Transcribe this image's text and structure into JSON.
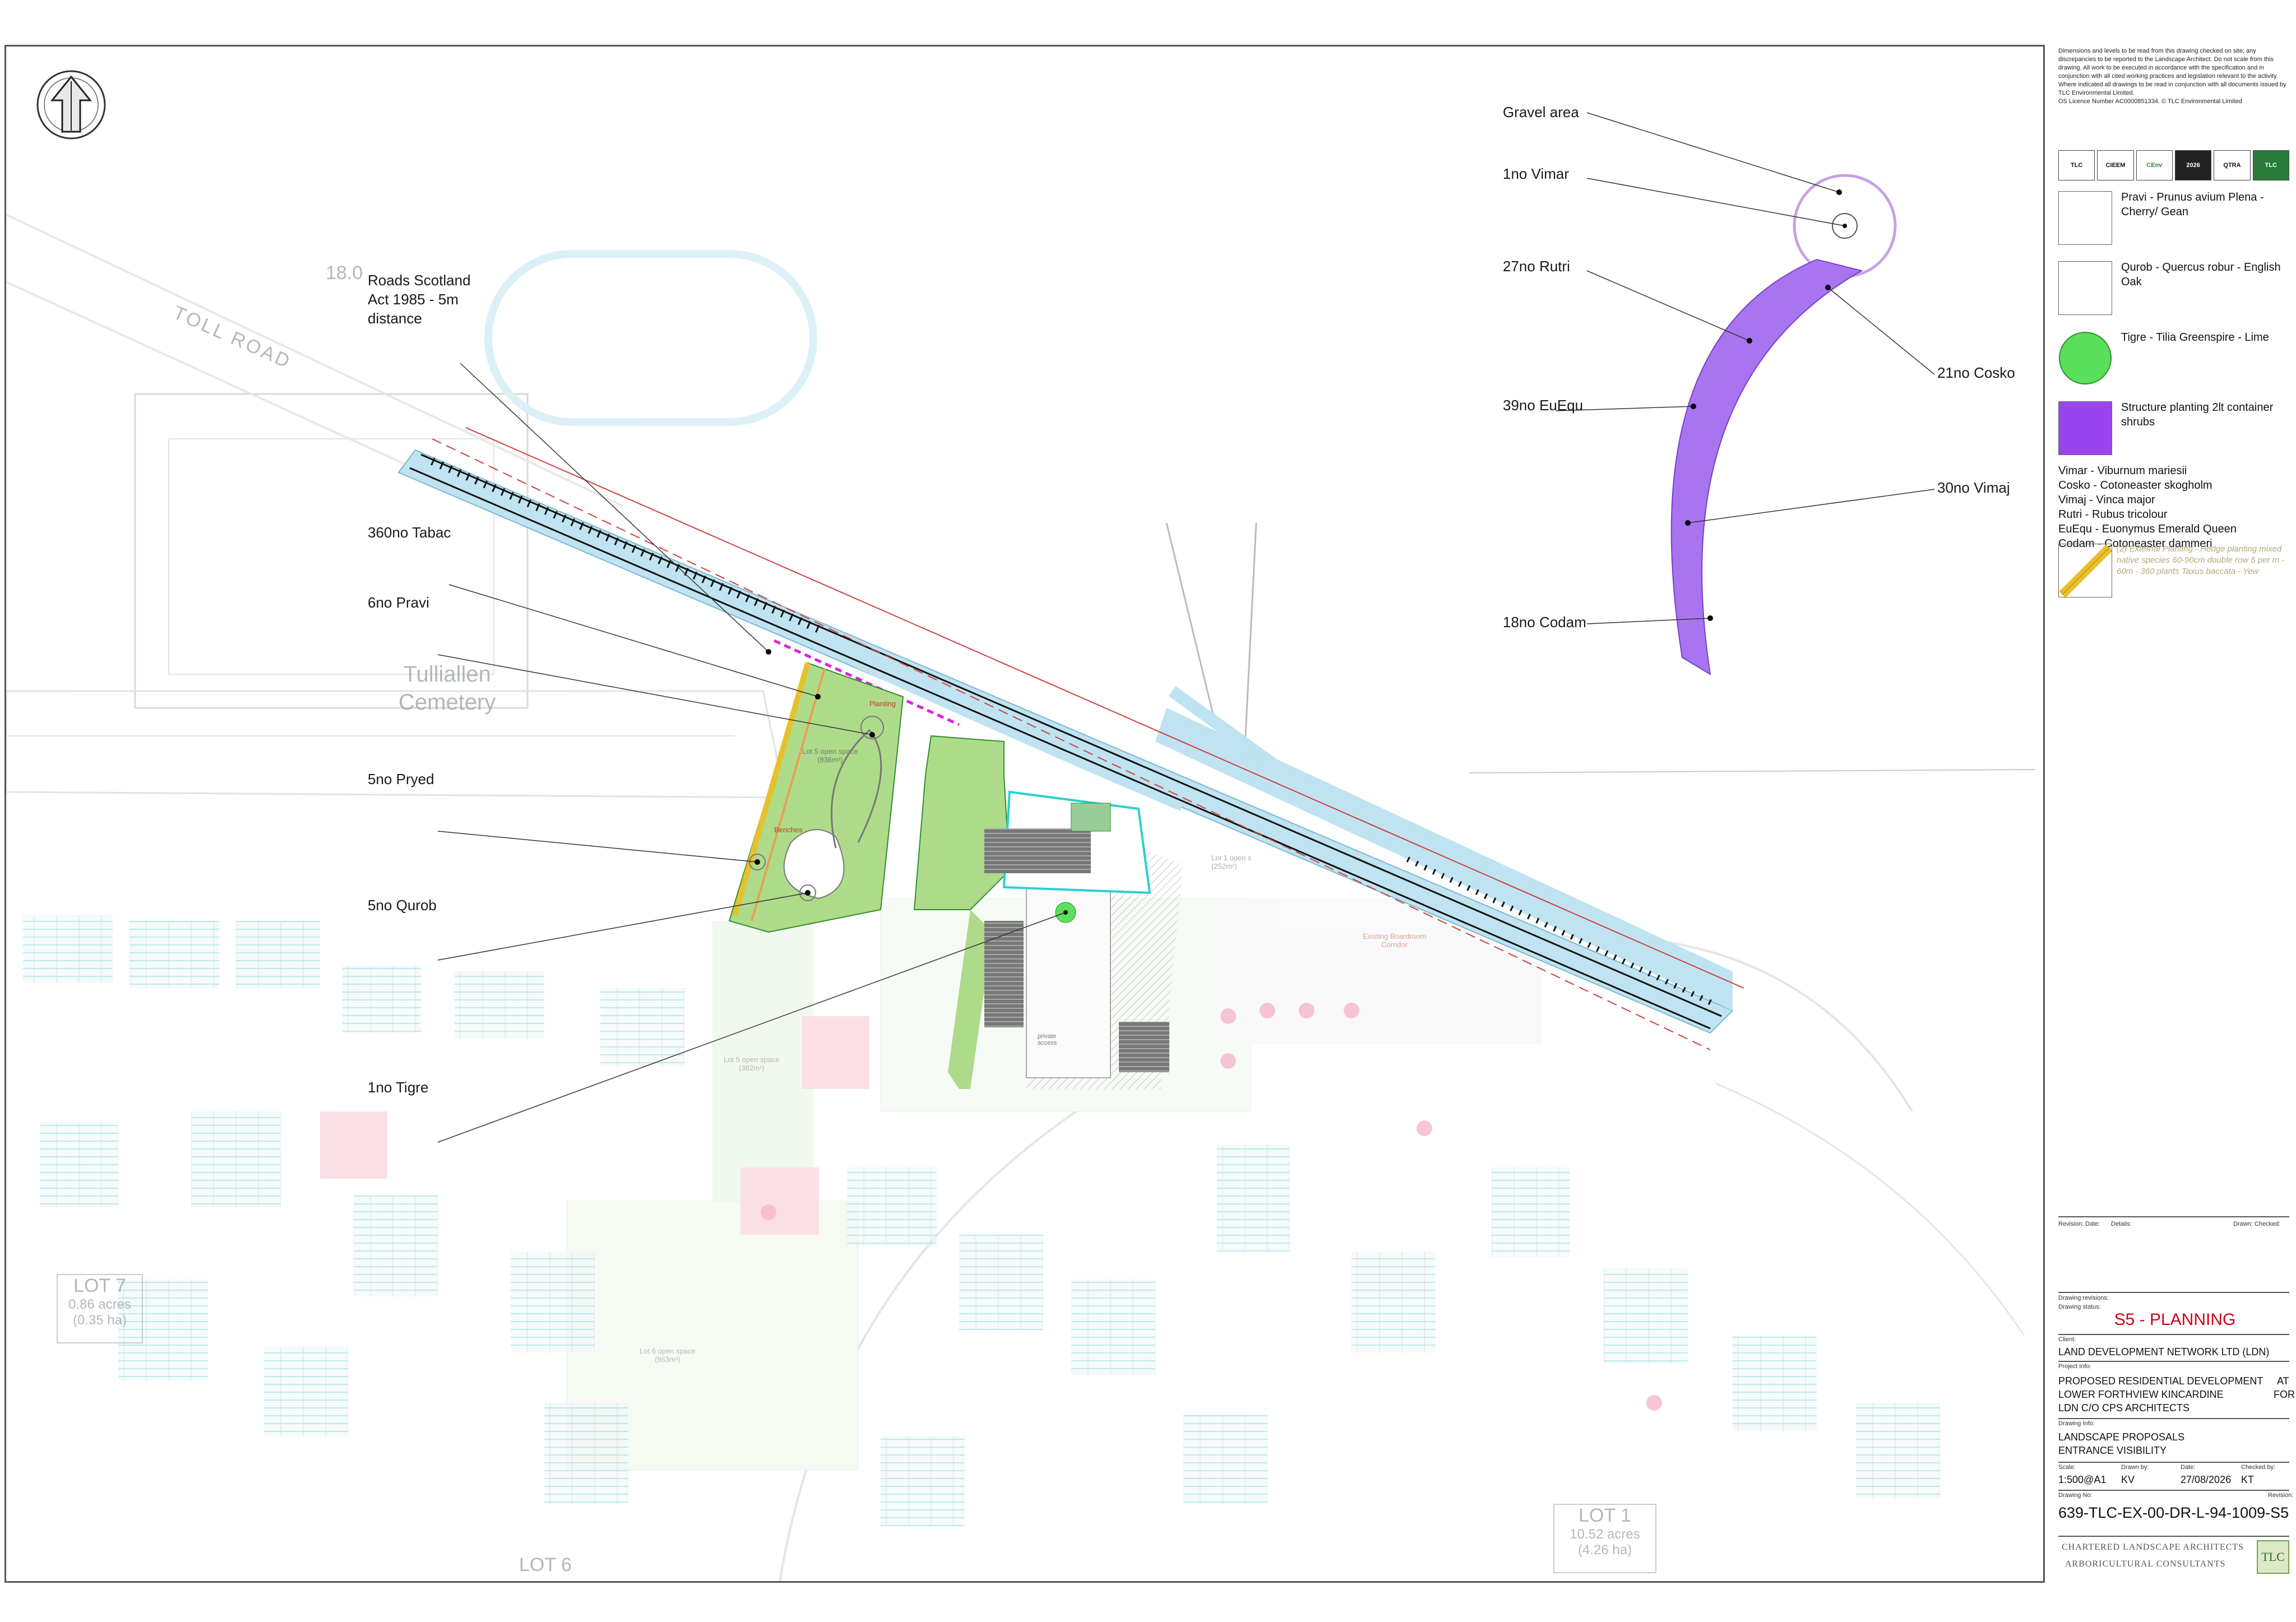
{
  "plan": {
    "callouts_left": {
      "roads_scotland": "Roads Scotland\nAct 1985 - 5m\ndistance",
      "tabac": "360no Tabac",
      "pravi": "6no Pravi",
      "pryed": "5no Pryed",
      "qurob": "5no Qurob",
      "tigre": "1no Tigre"
    },
    "callouts_detail": {
      "gravel": "Gravel area",
      "vimar": "1no Vimar",
      "rutri": "27no Rutri",
      "euequ": "39no EuEqu",
      "codam": "18no Codam",
      "cosko": "21no Cosko",
      "vimaj": "30no Vimaj"
    },
    "map_text": {
      "toll_road": "TOLL ROAD",
      "road_no": "18.0",
      "cemetery": "Tulliallen\nCemetery",
      "lot5_open_space": "Lot 5 open space\n(836m²)",
      "benches": "Benches",
      "planting": "Planting",
      "lot1_open_space": "Lot 1 open s\n(252m²)",
      "lot5_open_space_b": "Lot 5 open space\n(382m²)",
      "lot6_open_space": "Lot 6 open space\n(963m²)",
      "existing_woodland": "Existing Boardroom\nCorridor",
      "private_access": "private\naccess"
    },
    "lots": {
      "lot7": "LOT 7",
      "lot7_acres": "0.86 acres",
      "lot7_ha": "(0.35 ha)",
      "lot1": "LOT 1",
      "lot1_acres": "10.52 acres",
      "lot1_ha": "(4.26 ha)",
      "lot6": "LOT 6"
    }
  },
  "panel": {
    "disclaimer": "Dimensions and levels to be read from this drawing checked on site; any discrepancies to be reported to the Landscape Architect. Do not scale from this drawing. All work to be executed in accordance with the specification and in conjunction with all cited working practices and legislation relevant to the activity. Where indicated all drawings to be read in conjunction with all documents issued by TLC Environmental Limited.\nOS Licence Number AC0000851334. © TLC Environmental Limited",
    "logos": [
      "TLC",
      "CIEEM",
      "CEnv",
      "2026",
      "QTRA",
      "TLC"
    ],
    "key": [
      {
        "id": "pravi",
        "text": "Pravi - Prunus avium Plena - Cherry/ Gean",
        "fill": "#ffffff"
      },
      {
        "id": "qurob",
        "text": "Qurob - Quercus robur - English Oak",
        "fill": "#ffffff"
      },
      {
        "id": "tigre",
        "text": "Tigre - Tilia Greenspire - Lime",
        "fill": "#5ae05a"
      },
      {
        "id": "structure",
        "text": "Structure planting 2lt container shrubs",
        "fill": "#9a44f0"
      }
    ],
    "abbreviations": [
      "Vimar - Viburnum mariesii",
      "Cosko - Cotoneaster skogholm",
      "Vimaj - Vinca major",
      "Rutri - Rubus tricolour",
      "EuEqu - Euonymus Emerald Queen",
      "Codam - Cotoneaster dammeri"
    ],
    "hedge_key": "(2) External Planting - Hedge planting mixed native species 60-90cm double row 6 per m - 60m - 360 plants Taxus baccata - Yew",
    "revision_header": {
      "revision": "Revision:",
      "date": "Date:",
      "details": "Details:",
      "drawn_checked": "Drawn: Checked:"
    },
    "drawing_revisions_label": "Drawing revisions:",
    "drawing_status_label": "Drawing status:",
    "status": "S5 - PLANNING",
    "client_label": "Client:",
    "client": "LAND DEVELOPMENT NETWORK LTD (LDN)",
    "project_label": "Project Info:",
    "project_lines": [
      "PROPOSED RESIDENTIAL DEVELOPMENT",
      "LOWER FORTHVIEW KINCARDINE",
      "LDN C/O CPS ARCHITECTS"
    ],
    "project_at": "AT",
    "project_for": "FOR",
    "drawing_info_label": "Drawing Info:",
    "drawing_info": [
      "LANDSCAPE PROPOSALS",
      "ENTRANCE VISIBILITY"
    ],
    "meta_labels": {
      "scale": "Scale:",
      "drawn_by": "Drawn by:",
      "date": "Date:",
      "checked_by": "Checked by:"
    },
    "meta_values": {
      "scale": "1:500@A1",
      "drawn_by": "KV",
      "date": "27/08/2026",
      "checked_by": "KT"
    },
    "drawing_no_label": "Drawing No:",
    "revision_label": "Revision:",
    "drawing_no": "639-TLC-EX-00-DR-L-94-1009-S5",
    "company_line1": "CHARTERED LANDSCAPE ARCHITECTS",
    "company_line2": "ARBORICULTURAL CONSULTANTS",
    "company_logo": "TLC"
  },
  "colors": {
    "structure_purple": "#a974f0",
    "tree_green": "#5ae05a",
    "road_blue": "#bfe3f0",
    "status_red": "#d0021b",
    "hedge_yellow": "#e7c12b",
    "grass_green": "#aedb8a"
  }
}
